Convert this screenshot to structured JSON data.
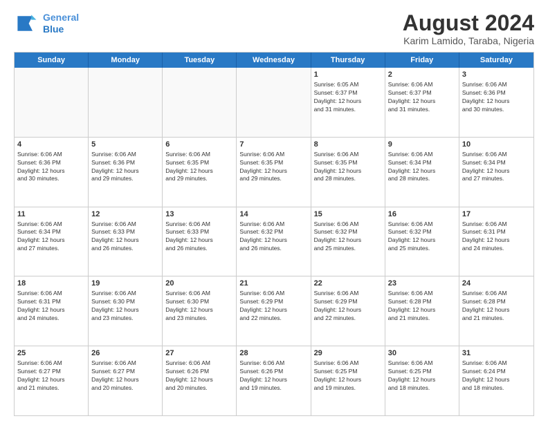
{
  "header": {
    "logo_line1": "General",
    "logo_line2": "Blue",
    "month": "August 2024",
    "location": "Karim Lamido, Taraba, Nigeria"
  },
  "days_of_week": [
    "Sunday",
    "Monday",
    "Tuesday",
    "Wednesday",
    "Thursday",
    "Friday",
    "Saturday"
  ],
  "rows": [
    [
      {
        "day": "",
        "info": ""
      },
      {
        "day": "",
        "info": ""
      },
      {
        "day": "",
        "info": ""
      },
      {
        "day": "",
        "info": ""
      },
      {
        "day": "1",
        "info": "Sunrise: 6:05 AM\nSunset: 6:37 PM\nDaylight: 12 hours\nand 31 minutes."
      },
      {
        "day": "2",
        "info": "Sunrise: 6:06 AM\nSunset: 6:37 PM\nDaylight: 12 hours\nand 31 minutes."
      },
      {
        "day": "3",
        "info": "Sunrise: 6:06 AM\nSunset: 6:36 PM\nDaylight: 12 hours\nand 30 minutes."
      }
    ],
    [
      {
        "day": "4",
        "info": "Sunrise: 6:06 AM\nSunset: 6:36 PM\nDaylight: 12 hours\nand 30 minutes."
      },
      {
        "day": "5",
        "info": "Sunrise: 6:06 AM\nSunset: 6:36 PM\nDaylight: 12 hours\nand 29 minutes."
      },
      {
        "day": "6",
        "info": "Sunrise: 6:06 AM\nSunset: 6:35 PM\nDaylight: 12 hours\nand 29 minutes."
      },
      {
        "day": "7",
        "info": "Sunrise: 6:06 AM\nSunset: 6:35 PM\nDaylight: 12 hours\nand 29 minutes."
      },
      {
        "day": "8",
        "info": "Sunrise: 6:06 AM\nSunset: 6:35 PM\nDaylight: 12 hours\nand 28 minutes."
      },
      {
        "day": "9",
        "info": "Sunrise: 6:06 AM\nSunset: 6:34 PM\nDaylight: 12 hours\nand 28 minutes."
      },
      {
        "day": "10",
        "info": "Sunrise: 6:06 AM\nSunset: 6:34 PM\nDaylight: 12 hours\nand 27 minutes."
      }
    ],
    [
      {
        "day": "11",
        "info": "Sunrise: 6:06 AM\nSunset: 6:34 PM\nDaylight: 12 hours\nand 27 minutes."
      },
      {
        "day": "12",
        "info": "Sunrise: 6:06 AM\nSunset: 6:33 PM\nDaylight: 12 hours\nand 26 minutes."
      },
      {
        "day": "13",
        "info": "Sunrise: 6:06 AM\nSunset: 6:33 PM\nDaylight: 12 hours\nand 26 minutes."
      },
      {
        "day": "14",
        "info": "Sunrise: 6:06 AM\nSunset: 6:32 PM\nDaylight: 12 hours\nand 26 minutes."
      },
      {
        "day": "15",
        "info": "Sunrise: 6:06 AM\nSunset: 6:32 PM\nDaylight: 12 hours\nand 25 minutes."
      },
      {
        "day": "16",
        "info": "Sunrise: 6:06 AM\nSunset: 6:32 PM\nDaylight: 12 hours\nand 25 minutes."
      },
      {
        "day": "17",
        "info": "Sunrise: 6:06 AM\nSunset: 6:31 PM\nDaylight: 12 hours\nand 24 minutes."
      }
    ],
    [
      {
        "day": "18",
        "info": "Sunrise: 6:06 AM\nSunset: 6:31 PM\nDaylight: 12 hours\nand 24 minutes."
      },
      {
        "day": "19",
        "info": "Sunrise: 6:06 AM\nSunset: 6:30 PM\nDaylight: 12 hours\nand 23 minutes."
      },
      {
        "day": "20",
        "info": "Sunrise: 6:06 AM\nSunset: 6:30 PM\nDaylight: 12 hours\nand 23 minutes."
      },
      {
        "day": "21",
        "info": "Sunrise: 6:06 AM\nSunset: 6:29 PM\nDaylight: 12 hours\nand 22 minutes."
      },
      {
        "day": "22",
        "info": "Sunrise: 6:06 AM\nSunset: 6:29 PM\nDaylight: 12 hours\nand 22 minutes."
      },
      {
        "day": "23",
        "info": "Sunrise: 6:06 AM\nSunset: 6:28 PM\nDaylight: 12 hours\nand 21 minutes."
      },
      {
        "day": "24",
        "info": "Sunrise: 6:06 AM\nSunset: 6:28 PM\nDaylight: 12 hours\nand 21 minutes."
      }
    ],
    [
      {
        "day": "25",
        "info": "Sunrise: 6:06 AM\nSunset: 6:27 PM\nDaylight: 12 hours\nand 21 minutes."
      },
      {
        "day": "26",
        "info": "Sunrise: 6:06 AM\nSunset: 6:27 PM\nDaylight: 12 hours\nand 20 minutes."
      },
      {
        "day": "27",
        "info": "Sunrise: 6:06 AM\nSunset: 6:26 PM\nDaylight: 12 hours\nand 20 minutes."
      },
      {
        "day": "28",
        "info": "Sunrise: 6:06 AM\nSunset: 6:26 PM\nDaylight: 12 hours\nand 19 minutes."
      },
      {
        "day": "29",
        "info": "Sunrise: 6:06 AM\nSunset: 6:25 PM\nDaylight: 12 hours\nand 19 minutes."
      },
      {
        "day": "30",
        "info": "Sunrise: 6:06 AM\nSunset: 6:25 PM\nDaylight: 12 hours\nand 18 minutes."
      },
      {
        "day": "31",
        "info": "Sunrise: 6:06 AM\nSunset: 6:24 PM\nDaylight: 12 hours\nand 18 minutes."
      }
    ]
  ]
}
